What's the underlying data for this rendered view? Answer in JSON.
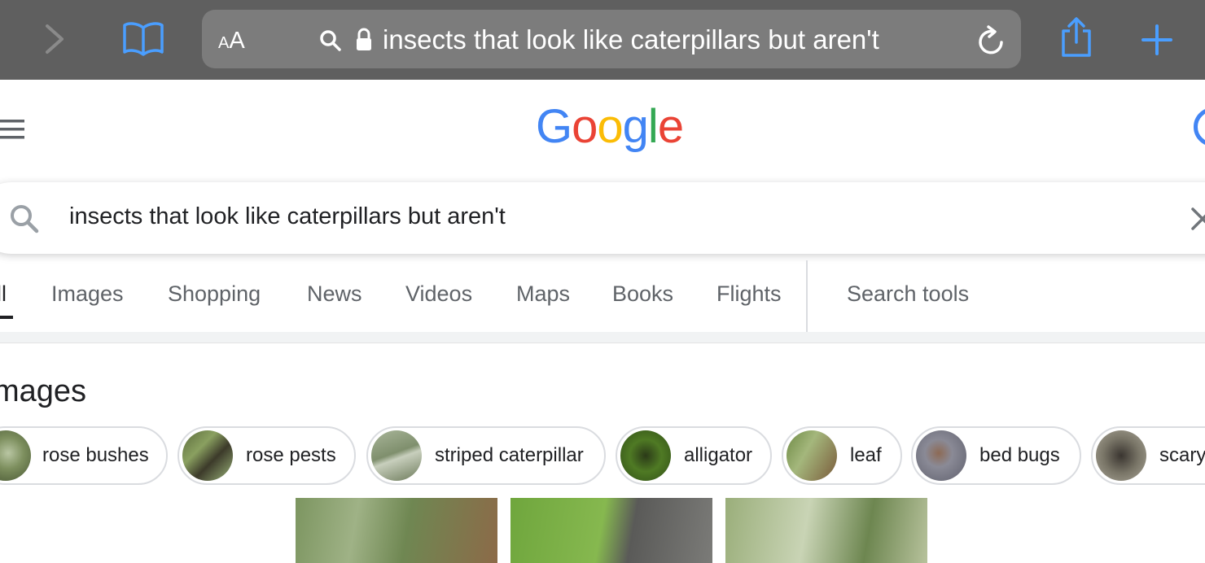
{
  "browser": {
    "text_size_label_small": "A",
    "text_size_label_large": "A",
    "address_text": "insects that look like caterpillars but aren't",
    "icons": [
      "forward-icon",
      "bookmarks-icon",
      "search-icon",
      "lock-icon",
      "reload-icon",
      "share-icon",
      "new-tab-icon"
    ],
    "toolbar_color": "#5f5f5f",
    "accent_color": "#4a9eff"
  },
  "google": {
    "logo_letters": [
      "G",
      "o",
      "o",
      "g",
      "l",
      "e"
    ],
    "logo_colors": [
      "#4285f4",
      "#ea4335",
      "#fbbc05",
      "#4285f4",
      "#34a853",
      "#ea4335"
    ],
    "search_query": "insects that look like caterpillars but aren't"
  },
  "tabs": {
    "items": [
      "ll",
      "Images",
      "Shopping",
      "News",
      "Videos",
      "Maps",
      "Books",
      "Flights"
    ],
    "active_index": 0,
    "tools_label": "Search tools"
  },
  "images_section": {
    "title": "mages",
    "chips": [
      "rose bushes",
      "rose pests",
      "striped caterpillar",
      "alligator",
      "leaf",
      "bed bugs",
      "scary"
    ]
  }
}
